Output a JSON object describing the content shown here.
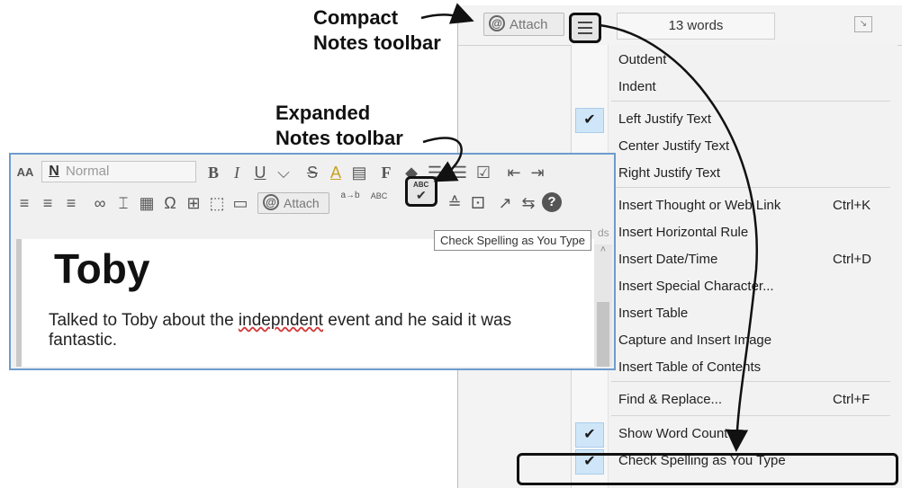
{
  "callouts": {
    "compact": [
      "Compact",
      "Notes toolbar"
    ],
    "expanded": [
      "Expanded",
      "Notes toolbar"
    ]
  },
  "compact_toolbar": {
    "attach_label": "Attach",
    "word_count": "13 words",
    "menu_button_icon": "hamburger-icon"
  },
  "menu": {
    "items": [
      {
        "label": "Outdent",
        "shortcut": "",
        "checked": false
      },
      {
        "label": "Indent",
        "shortcut": "",
        "checked": false
      },
      {
        "label": "Left Justify Text",
        "shortcut": "",
        "checked": true
      },
      {
        "label": "Center Justify Text",
        "shortcut": "",
        "checked": false
      },
      {
        "label": "Right Justify Text",
        "shortcut": "",
        "checked": false
      },
      {
        "label": "Insert Thought or Web Link",
        "shortcut": "Ctrl+K",
        "checked": false
      },
      {
        "label": "Insert Horizontal Rule",
        "shortcut": "",
        "checked": false
      },
      {
        "label": "Insert Date/Time",
        "shortcut": "Ctrl+D",
        "checked": false
      },
      {
        "label": "Insert Special Character...",
        "shortcut": "",
        "checked": false
      },
      {
        "label": "Insert Table",
        "shortcut": "",
        "checked": false
      },
      {
        "label": "Capture and Insert Image",
        "shortcut": "",
        "checked": false
      },
      {
        "label": "Insert Table of Contents",
        "shortcut": "",
        "checked": false
      },
      {
        "label": "Find & Replace...",
        "shortcut": "Ctrl+F",
        "checked": false
      },
      {
        "label": "Show Word Count",
        "shortcut": "",
        "checked": true
      },
      {
        "label": "Check Spelling as You Type",
        "shortcut": "",
        "checked": true
      }
    ]
  },
  "expanded_toolbar": {
    "font_size_icon": "AA",
    "style_value": "Normal",
    "style_icon": "N",
    "row1_glyphs": [
      "B",
      "I",
      "U",
      "⌵",
      "S",
      "A",
      "▤",
      "F",
      "◆",
      "☰",
      "☰",
      "☑",
      "⇤",
      "⇥"
    ],
    "row2_glyphs": [
      "≡",
      "≡",
      "≡",
      "∞",
      "⌶",
      "▦",
      "Ω",
      "⊞",
      "⬚",
      "▭"
    ],
    "attach_label": "Attach",
    "replace_icon": "a→b",
    "spell_check_text": "ABC",
    "tooltip": "Check Spelling as You Type",
    "after_glyphs": [
      "≙",
      "⚀",
      "↗",
      "⇆",
      "?"
    ],
    "word_count_fragment": "ds"
  },
  "note": {
    "title": "Toby",
    "body_before": "Talked to Toby about the ",
    "body_misspelled": "indepndent",
    "body_after": " event and he said it was fantastic."
  }
}
